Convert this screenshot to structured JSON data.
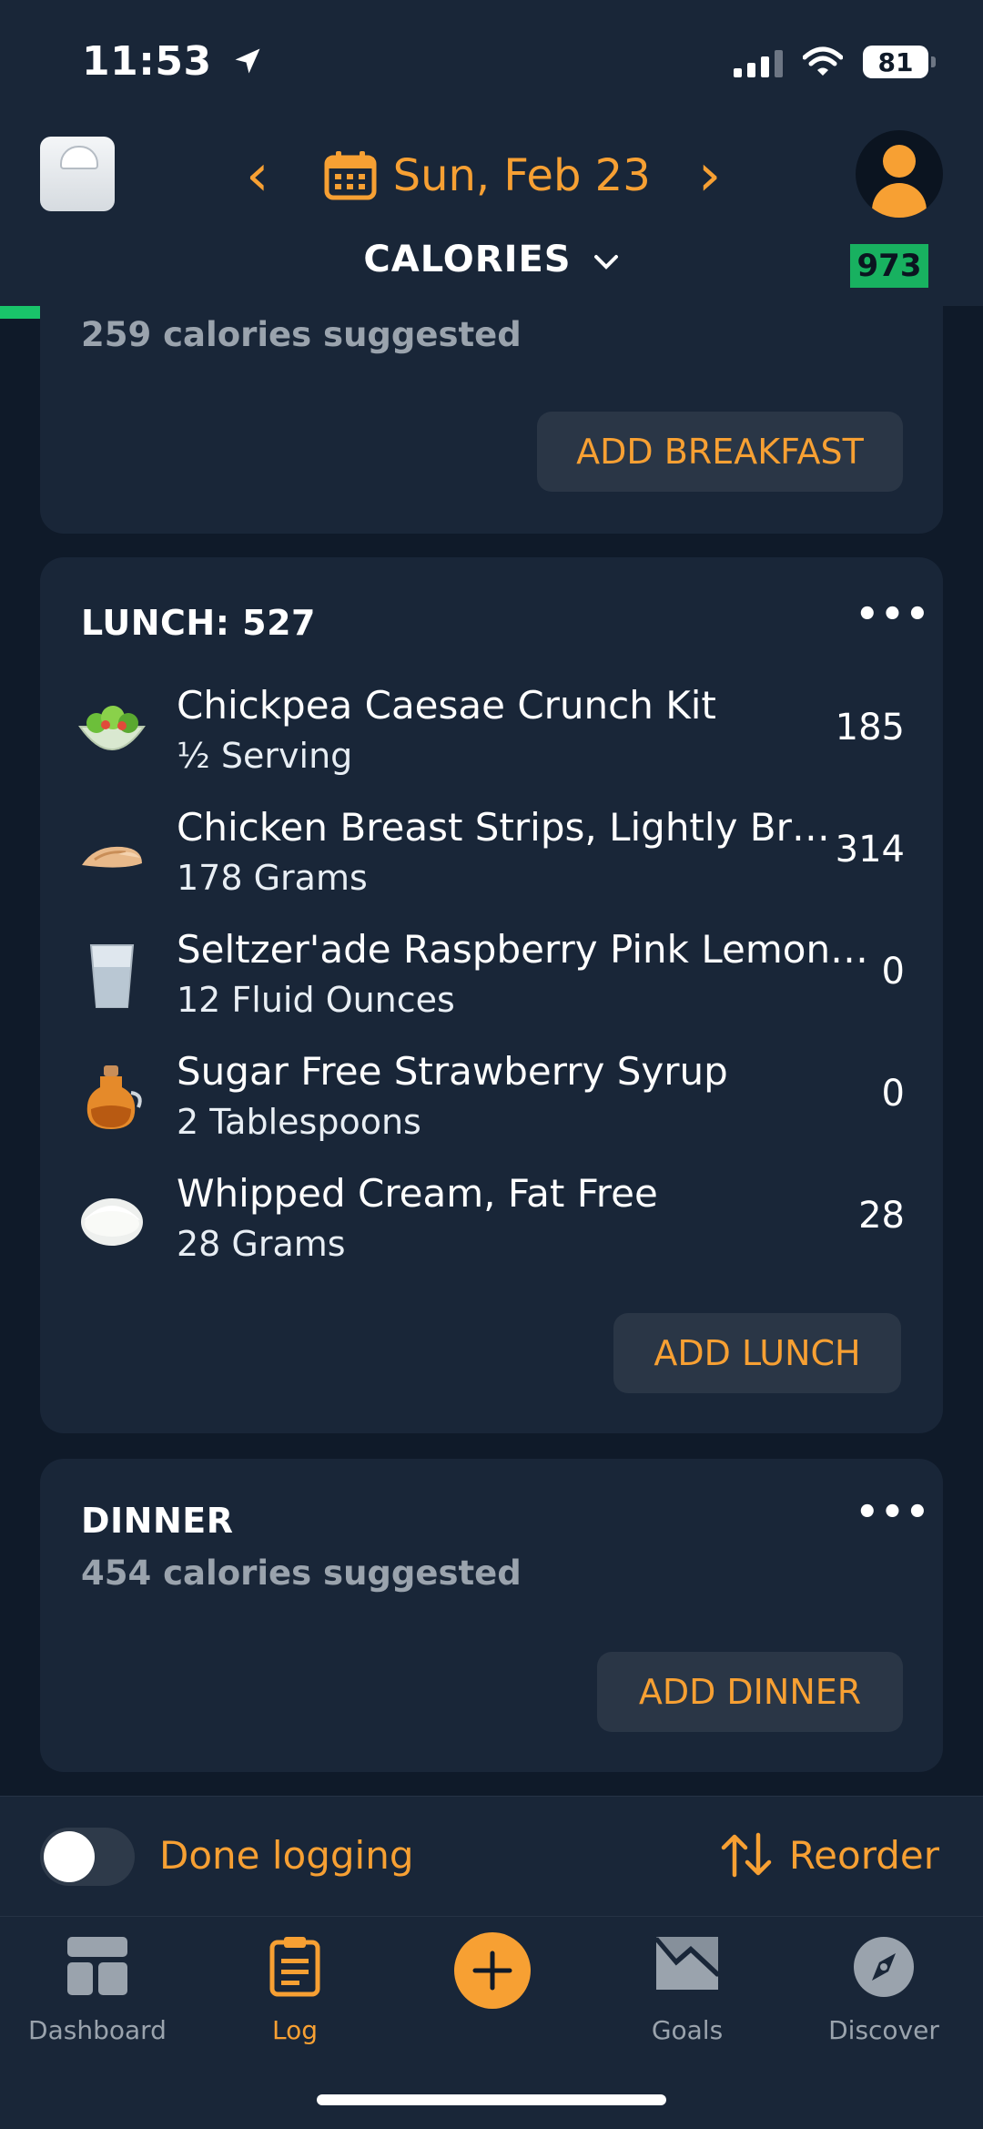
{
  "status": {
    "time": "11:53",
    "battery": "81"
  },
  "header": {
    "date": "Sun, Feb 23",
    "view_label": "CALORIES",
    "remaining": "973",
    "progress_fraction": 0.29,
    "progress_marker_fraction": 0.83
  },
  "breakfast": {
    "suggested": "259 calories suggested",
    "add_label": "ADD BREAKFAST"
  },
  "lunch": {
    "title": "LUNCH: 527",
    "items": [
      {
        "name": "Chickpea Caesae Crunch Kit",
        "serving": "½ Serving",
        "calories": "185",
        "icon": "salad-icon"
      },
      {
        "name": "Chicken Breast Strips, Lightly Br…",
        "serving": "178 Grams",
        "calories": "314",
        "icon": "chicken-icon"
      },
      {
        "name": "Seltzer'ade Raspberry Pink Lemon…",
        "serving": "12 Fluid Ounces",
        "calories": "0",
        "icon": "glass-icon"
      },
      {
        "name": "Sugar Free Strawberry Syrup",
        "serving": "2 Tablespoons",
        "calories": "0",
        "icon": "syrup-icon"
      },
      {
        "name": "Whipped Cream, Fat Free",
        "serving": "28 Grams",
        "calories": "28",
        "icon": "cream-icon"
      }
    ],
    "add_label": "ADD LUNCH"
  },
  "dinner": {
    "title": "DINNER",
    "suggested": "454 calories suggested",
    "add_label": "ADD DINNER"
  },
  "footer": {
    "done_logging": "Done logging",
    "reorder": "Reorder"
  },
  "tabs": [
    {
      "label": "Dashboard"
    },
    {
      "label": "Log"
    },
    {
      "label": ""
    },
    {
      "label": "Goals"
    },
    {
      "label": "Discover"
    }
  ],
  "colors": {
    "accent": "#f7a033",
    "progress": "#19c46a",
    "badge": "#18b160"
  }
}
